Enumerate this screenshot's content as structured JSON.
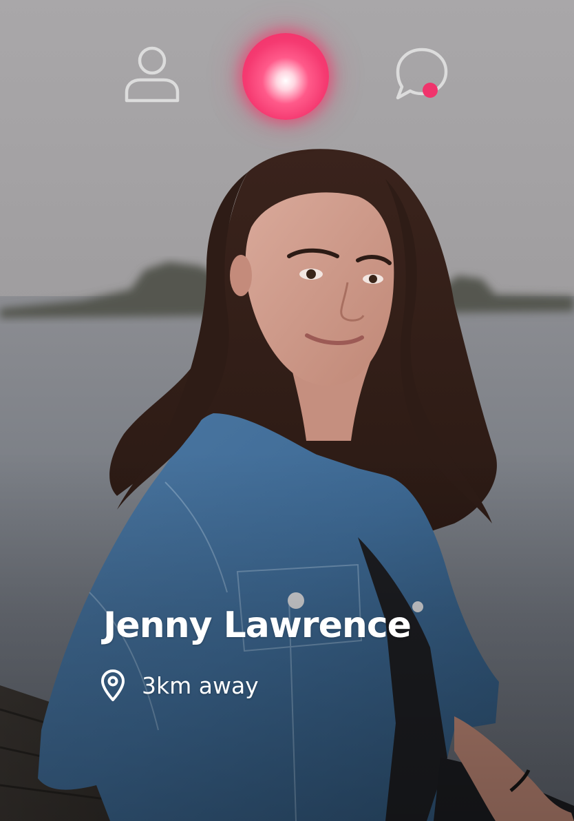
{
  "nav": {
    "profile_icon": "user-icon",
    "home_icon": "glowing-orb-icon",
    "chat_icon": "chat-bubble-icon",
    "chat_has_unread": true
  },
  "profile": {
    "name": "Jenny Lawrence",
    "distance": "3km away",
    "location_icon": "location-pin-icon",
    "photo_subject": "woman-in-denim-jacket-by-the-sea"
  },
  "colors": {
    "accent": "#f0346c",
    "nav_icon_outline": "#dcdcdc",
    "text": "#ffffff"
  }
}
